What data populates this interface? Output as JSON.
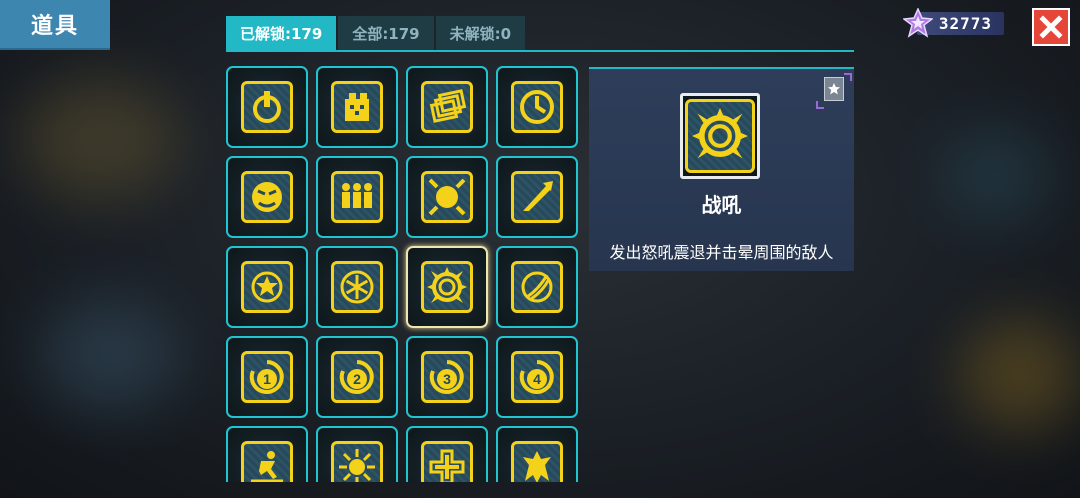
{
  "header": {
    "title": "道具"
  },
  "currency": {
    "icon": "star-gem-icon",
    "value": "32773"
  },
  "tabs": [
    {
      "label": "已解锁:179",
      "active": true
    },
    {
      "label": "全部:179",
      "active": false
    },
    {
      "label": "未解锁:0",
      "active": false
    }
  ],
  "items": [
    {
      "icon": "power-icon"
    },
    {
      "icon": "gift-box-icon"
    },
    {
      "icon": "stacked-cards-icon"
    },
    {
      "icon": "clock-icon"
    },
    {
      "icon": "angry-face-icon"
    },
    {
      "icon": "three-figures-icon"
    },
    {
      "icon": "blast-sun-icon"
    },
    {
      "icon": "slash-icon"
    },
    {
      "icon": "gear-burst-icon"
    },
    {
      "icon": "snowflake-icon"
    },
    {
      "icon": "roar-icon",
      "selected": true
    },
    {
      "icon": "claw-strike-icon"
    },
    {
      "icon": "number-1-icon",
      "text": "1"
    },
    {
      "icon": "number-2-icon",
      "text": "2"
    },
    {
      "icon": "number-3-icon",
      "text": "3"
    },
    {
      "icon": "number-4-icon",
      "text": "4"
    },
    {
      "icon": "runner-icon"
    },
    {
      "icon": "sunburst-icon"
    },
    {
      "icon": "cross-icon"
    },
    {
      "icon": "dragon-icon"
    }
  ],
  "detail": {
    "name": "战吼",
    "description": "发出怒吼震退并击晕周围的敌人",
    "icon": "roar-icon"
  },
  "colors": {
    "accent": "#22b8c6",
    "icon_yellow": "#f4d21a",
    "close_red": "#e6453a",
    "title_blue": "#3d86b0"
  }
}
